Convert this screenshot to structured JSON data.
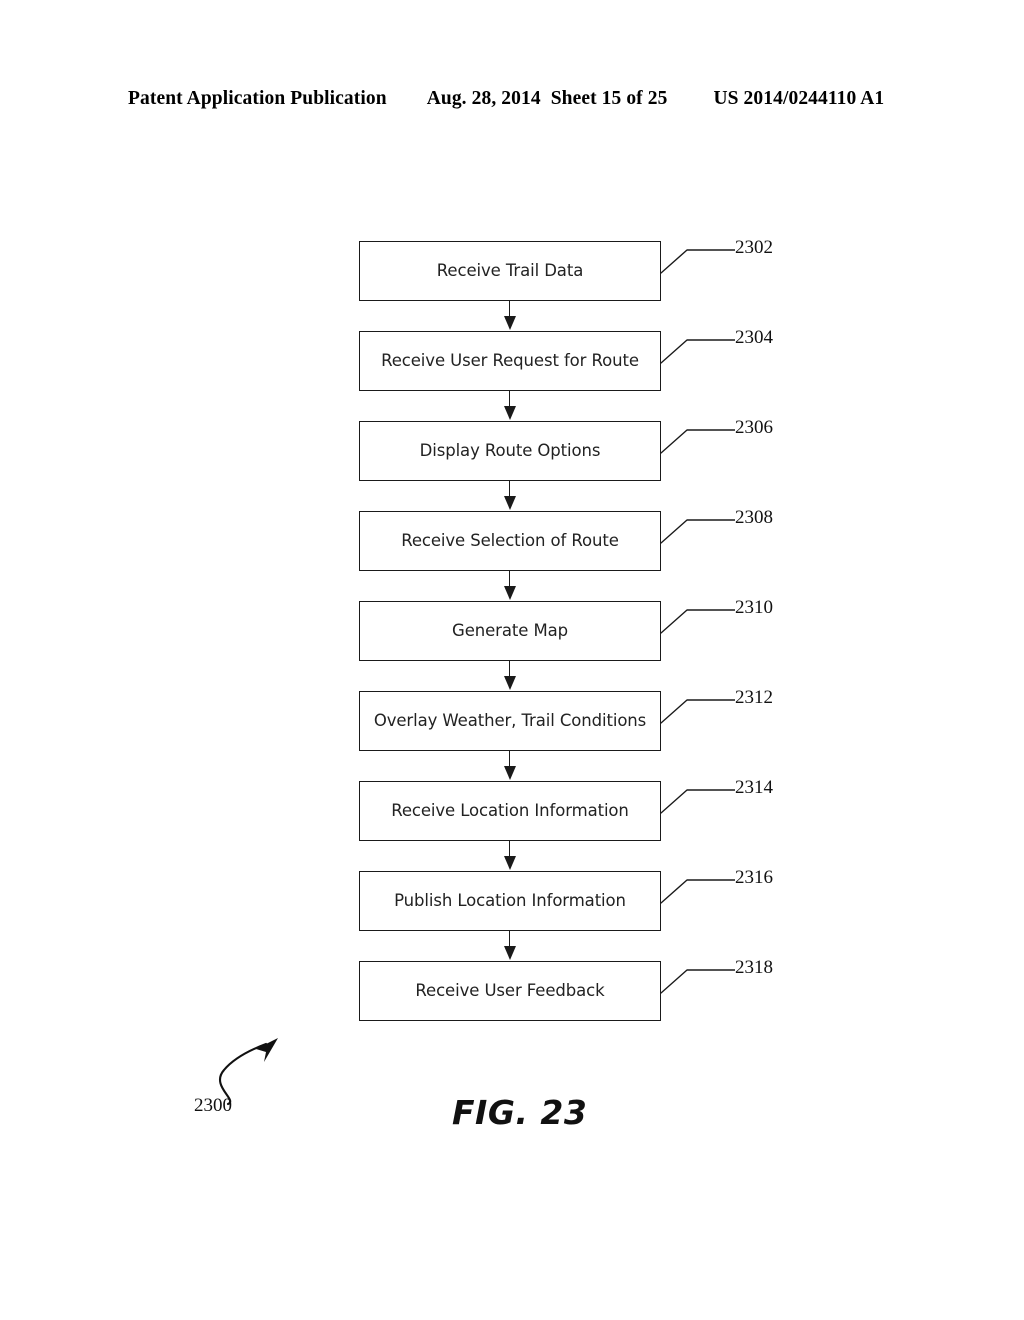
{
  "header": {
    "publication": "Patent Application Publication",
    "date": "Aug. 28, 2014",
    "sheet": "Sheet 15 of 25",
    "document_number": "US 2014/0244110 A1"
  },
  "figure": {
    "caption": "FIG. 23",
    "diagram_ref": "2300",
    "type": "flowchart",
    "orientation": "vertical",
    "colors": {
      "line": "#1a1a1a",
      "text": "#222222",
      "background": "#ffffff"
    }
  },
  "flowchart": {
    "steps": [
      {
        "ref": "2302",
        "label": "Receive Trail Data"
      },
      {
        "ref": "2304",
        "label": "Receive User Request for Route"
      },
      {
        "ref": "2306",
        "label": "Display Route Options"
      },
      {
        "ref": "2308",
        "label": "Receive Selection of Route"
      },
      {
        "ref": "2310",
        "label": "Generate Map"
      },
      {
        "ref": "2312",
        "label": "Overlay Weather, Trail Conditions"
      },
      {
        "ref": "2314",
        "label": "Receive Location Information"
      },
      {
        "ref": "2316",
        "label": "Publish Location Information"
      },
      {
        "ref": "2318",
        "label": "Receive User Feedback"
      }
    ]
  }
}
